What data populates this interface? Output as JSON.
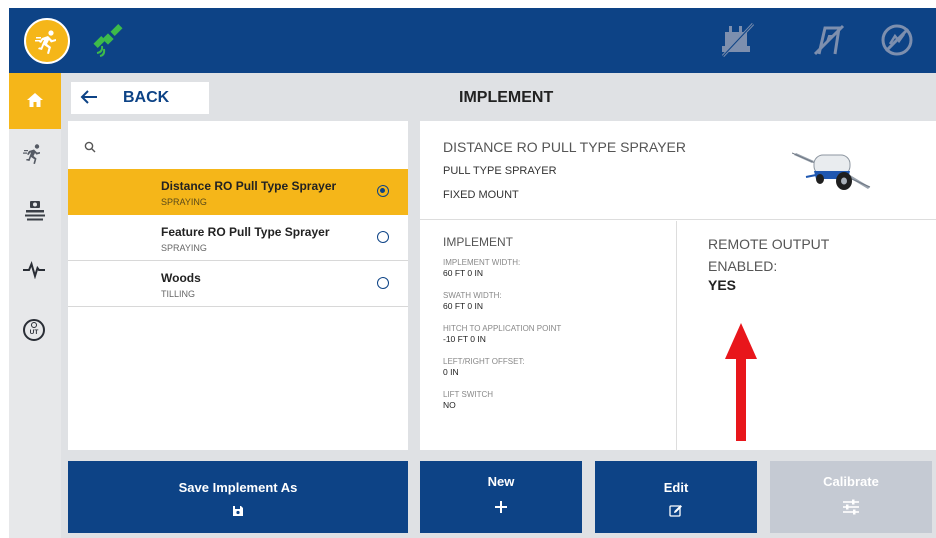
{
  "topbar": {
    "icons": [
      "runner-logo-icon",
      "satellite-icon",
      "no-implement-icon",
      "no-steering-icon",
      "no-rate-icon"
    ]
  },
  "sidebar": {
    "items": [
      "home-icon",
      "run-icon",
      "implement-icon",
      "diagnostics-icon",
      "isobus-ut-icon"
    ],
    "ut_label": "UT"
  },
  "header": {
    "back_label": "BACK",
    "title": "IMPLEMENT"
  },
  "list": {
    "items": [
      {
        "name": "Distance RO Pull Type Sprayer",
        "type": "SPRAYING",
        "selected": true
      },
      {
        "name": "Feature RO Pull Type Sprayer",
        "type": "SPRAYING",
        "selected": false
      },
      {
        "name": "Woods",
        "type": "TILLING",
        "selected": false
      }
    ]
  },
  "detail": {
    "title": "DISTANCE RO PULL TYPE SPRAYER",
    "subtitle1": "PULL TYPE SPRAYER",
    "subtitle2": "FIXED MOUNT",
    "implement_heading": "IMPLEMENT",
    "specs": [
      {
        "label": "IMPLEMENT WIDTH:",
        "value": "60 FT 0 IN"
      },
      {
        "label": "SWATH WIDTH:",
        "value": "60 FT 0 IN"
      },
      {
        "label": "HITCH TO APPLICATION POINT",
        "value": "-10 FT 0 IN"
      },
      {
        "label": "LEFT/RIGHT OFFSET:",
        "value": "0 IN"
      },
      {
        "label": "LIFT SWITCH",
        "value": "NO"
      }
    ],
    "remote_heading": "REMOTE OUTPUT ENABLED:",
    "remote_value": "YES"
  },
  "buttons": {
    "save_as": "Save Implement As",
    "new": "New",
    "edit": "Edit",
    "calibrate": "Calibrate"
  },
  "colors": {
    "brand_blue": "#0d4386",
    "accent_yellow": "#f5b619",
    "satellite_green": "#3dbb4a",
    "disabled": "#c5cad3",
    "annotation_red": "#e8161b"
  }
}
